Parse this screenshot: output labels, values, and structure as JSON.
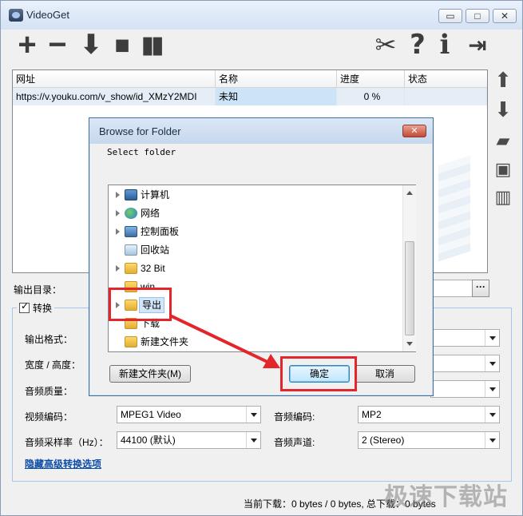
{
  "window": {
    "title": "VideoGet"
  },
  "window_controls": {
    "minimize": "▭",
    "maximize": "□",
    "close": "✕"
  },
  "grid": {
    "columns": [
      "网址",
      "名称",
      "进度",
      "状态"
    ],
    "rows": [
      {
        "url": "https://v.youku.com/v_show/id_XMzY2MDI",
        "name": "未知",
        "progress": "0 %",
        "status": ""
      }
    ]
  },
  "output_dir_label": "输出目录：",
  "convert": {
    "checkbox_label": "转换",
    "format_label": "输出格式：",
    "size_label": "宽度 / 高度：",
    "audio_quality_label": "音频质量：",
    "video_codec_label": "视频编码：",
    "video_codec_value": "MPEG1 Video",
    "audio_codec_label": "音频编码:",
    "audio_codec_value": "MP2",
    "sample_rate_label": "音频采样率（Hz）：",
    "sample_rate_value": "44100 (默认)",
    "channels_label": "音频声道:",
    "channels_value": "2 (Stereo)",
    "hide_advanced_link": "隐藏高级转换选项"
  },
  "status_bar": "当前下载：0 bytes / 0 bytes,  总下载：0 bytes",
  "watermark": "极速下载站",
  "dialog": {
    "title": "Browse for Folder",
    "close": "✕",
    "prompt": "Select folder",
    "tree": [
      {
        "label": "计算机",
        "icon": "computer-icon",
        "expandable": true
      },
      {
        "label": "网络",
        "icon": "network-icon",
        "expandable": true
      },
      {
        "label": "控制面板",
        "icon": "control-panel-icon",
        "expandable": true
      },
      {
        "label": "回收站",
        "icon": "recycle-bin-icon",
        "expandable": false
      },
      {
        "label": "32 Bit",
        "icon": "folder-icon",
        "expandable": true
      },
      {
        "label": "win",
        "icon": "folder-icon",
        "expandable": false
      },
      {
        "label": "导出",
        "icon": "folder-icon",
        "expandable": true,
        "selected": true
      },
      {
        "label": "下载",
        "icon": "folder-icon",
        "expandable": false
      },
      {
        "label": "新建文件夹",
        "icon": "folder-icon",
        "expandable": false
      }
    ],
    "new_folder_button": "新建文件夹(M)",
    "ok_button": "确定",
    "cancel_button": "取消"
  },
  "colors": {
    "highlight": "#e2262b",
    "link": "#0b4ca8",
    "selection": "#cde3f7"
  }
}
